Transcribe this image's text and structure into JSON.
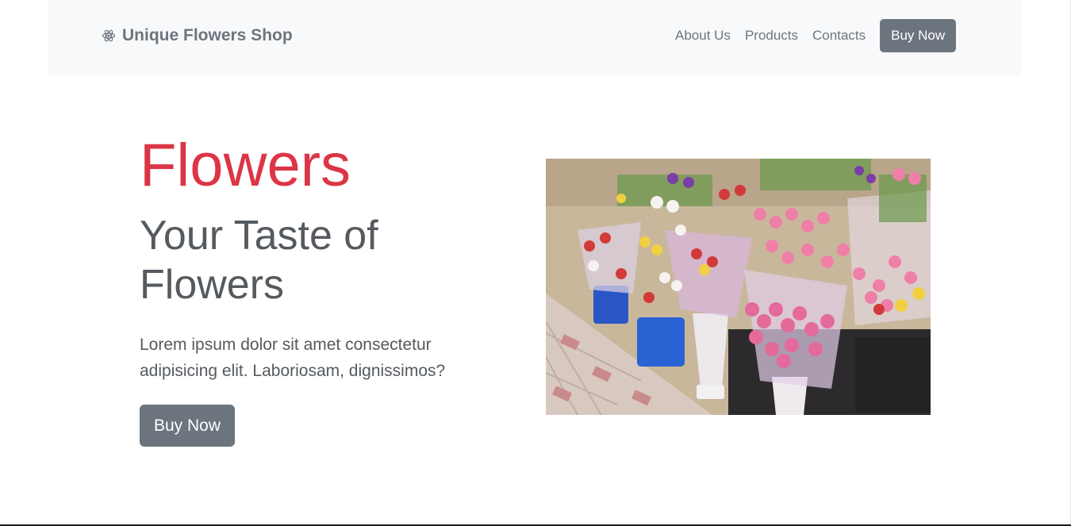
{
  "navbar": {
    "brand_icon": "react-atom-icon",
    "brand": "Unique Flowers Shop",
    "links": [
      "About Us",
      "Products",
      "Contacts"
    ],
    "cta": "Buy Now"
  },
  "hero": {
    "title": "Flowers",
    "subtitle": "Your Taste of Flowers",
    "text": "Lorem ipsum dolor sit amet consectetur adipisicing elit. Laboriosam, dignissimos?",
    "cta": "Buy Now",
    "image_alt": "tulip bouquets in buckets at a flower stall"
  },
  "colors": {
    "accent": "#dc3545",
    "secondary": "#6c757d",
    "navbar_bg": "#f8f9fa",
    "body_text": "#555a5f"
  }
}
